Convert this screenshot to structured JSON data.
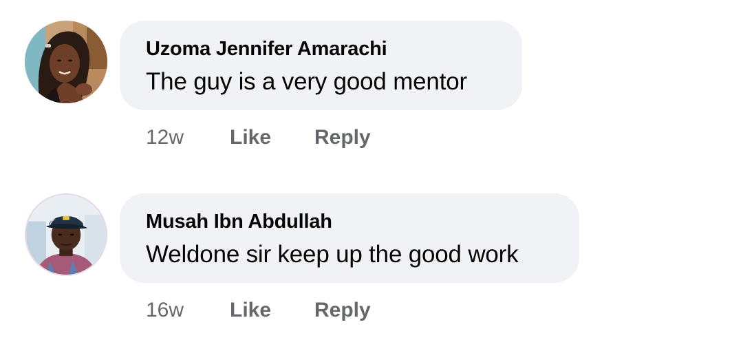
{
  "comments": [
    {
      "author": "Uzoma Jennifer Amarachi",
      "text": "The guy is a very good mentor",
      "timestamp": "12w",
      "like_label": "Like",
      "reply_label": "Reply",
      "avatar_icon": "profile-photo-woman"
    },
    {
      "author": "Musah Ibn Abdullah",
      "text": "Weldone sir keep up the good work",
      "timestamp": "16w",
      "like_label": "Like",
      "reply_label": "Reply",
      "avatar_icon": "profile-photo-man-cap"
    }
  ],
  "colors": {
    "bubble_background": "#f0f2f5",
    "primary_text": "#050505",
    "secondary_text": "#65676b"
  }
}
